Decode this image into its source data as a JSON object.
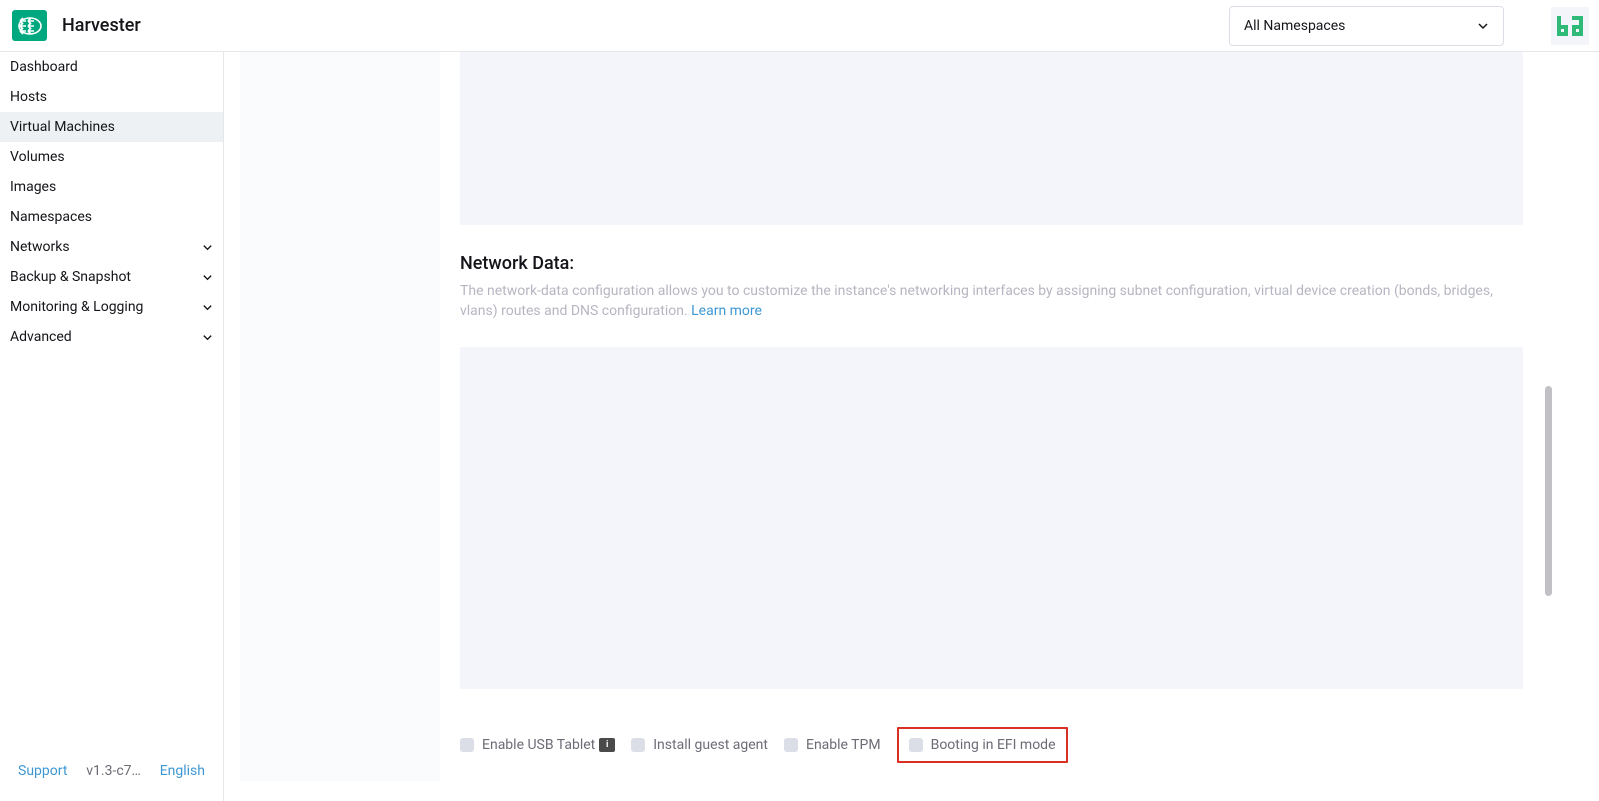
{
  "header": {
    "appTitle": "Harvester",
    "namespaceSelector": "All Namespaces"
  },
  "sidebar": {
    "items": [
      {
        "label": "Dashboard",
        "expandable": false
      },
      {
        "label": "Hosts",
        "expandable": false
      },
      {
        "label": "Virtual Machines",
        "expandable": false,
        "active": true
      },
      {
        "label": "Volumes",
        "expandable": false
      },
      {
        "label": "Images",
        "expandable": false
      },
      {
        "label": "Namespaces",
        "expandable": false
      },
      {
        "label": "Networks",
        "expandable": true
      },
      {
        "label": "Backup & Snapshot",
        "expandable": true
      },
      {
        "label": "Monitoring & Logging",
        "expandable": true
      },
      {
        "label": "Advanced",
        "expandable": true
      }
    ],
    "footer": {
      "support": "Support",
      "version": "v1.3-c7…",
      "lang": "English"
    }
  },
  "content": {
    "networkData": {
      "title": "Network Data:",
      "description": "The network-data configuration allows you to customize the instance's networking interfaces by assigning subnet configuration, virtual device creation (bonds, bridges, vlans) routes and DNS configuration. ",
      "learnMore": "Learn more"
    },
    "checkboxes": {
      "usbTablet": "Enable USB Tablet",
      "guestAgent": "Install guest agent",
      "tpm": "Enable TPM",
      "efi": "Booting in EFI mode"
    }
  }
}
